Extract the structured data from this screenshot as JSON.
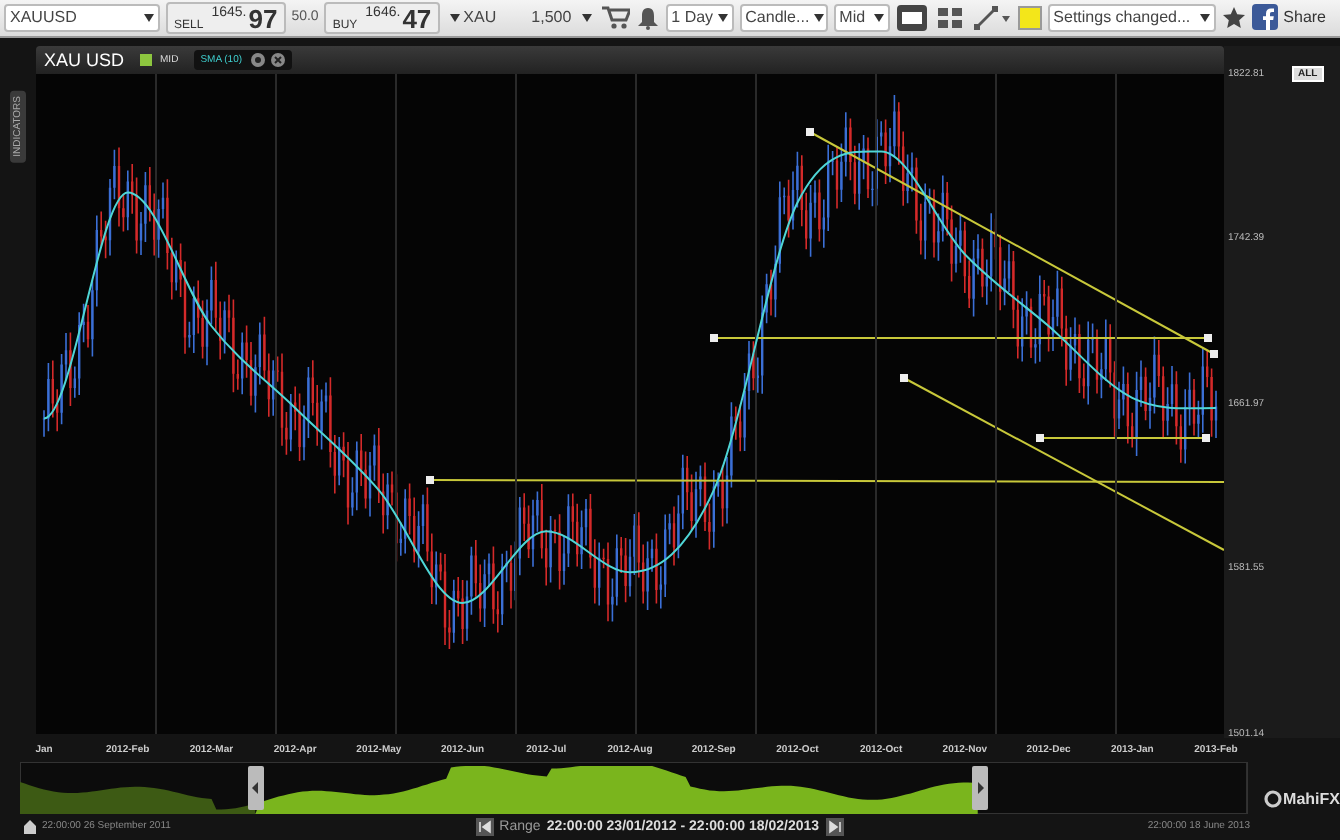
{
  "toolbar": {
    "symbol": "XAUUSD",
    "sell": {
      "label": "SELL",
      "price_small": "1645.",
      "price_big": "97"
    },
    "spread": "50.0",
    "buy": {
      "label": "BUY",
      "price_small": "1646.",
      "price_big": "47"
    },
    "unit": "XAU",
    "quantity": "1,500",
    "interval": "1 Day",
    "chart_type": "Candle...",
    "price_basis": "Mid",
    "settings": "Settings changed...",
    "share": "Share"
  },
  "side_tab": "INDICATORS",
  "chart": {
    "title": "XAU USD",
    "series_label": "MID",
    "all_button": "ALL",
    "chart_data": {
      "type": "line",
      "ylim": [
        1501.14,
        1822.81
      ],
      "yticks": [
        1822.81,
        1742.39,
        1661.97,
        1581.55,
        1501.14
      ],
      "categories": [
        "Jan",
        "2012-Feb",
        "2012-Mar",
        "2012-Apr",
        "2012-May",
        "2012-Jun",
        "2012-Jul",
        "2012-Aug",
        "2012-Sep",
        "2012-Oct",
        "2012-Oct",
        "2012-Nov",
        "2012-Dec",
        "2013-Jan",
        "2013-Feb"
      ],
      "series": [
        {
          "name": "SMA (10)",
          "color": "#4fd6d6",
          "values": [
            1655,
            1765,
            1700,
            1660,
            1620,
            1565,
            1600,
            1580,
            1620,
            1760,
            1785,
            1735,
            1700,
            1665,
            1660
          ]
        }
      ]
    }
  },
  "navigator": {
    "start": "22:00:00 26 September 2011",
    "range_label": "Range",
    "range": "22:00:00 23/01/2012 - 22:00:00 18/02/2013",
    "end": "22:00:00 18 June 2013"
  },
  "logo": "MahiFX"
}
